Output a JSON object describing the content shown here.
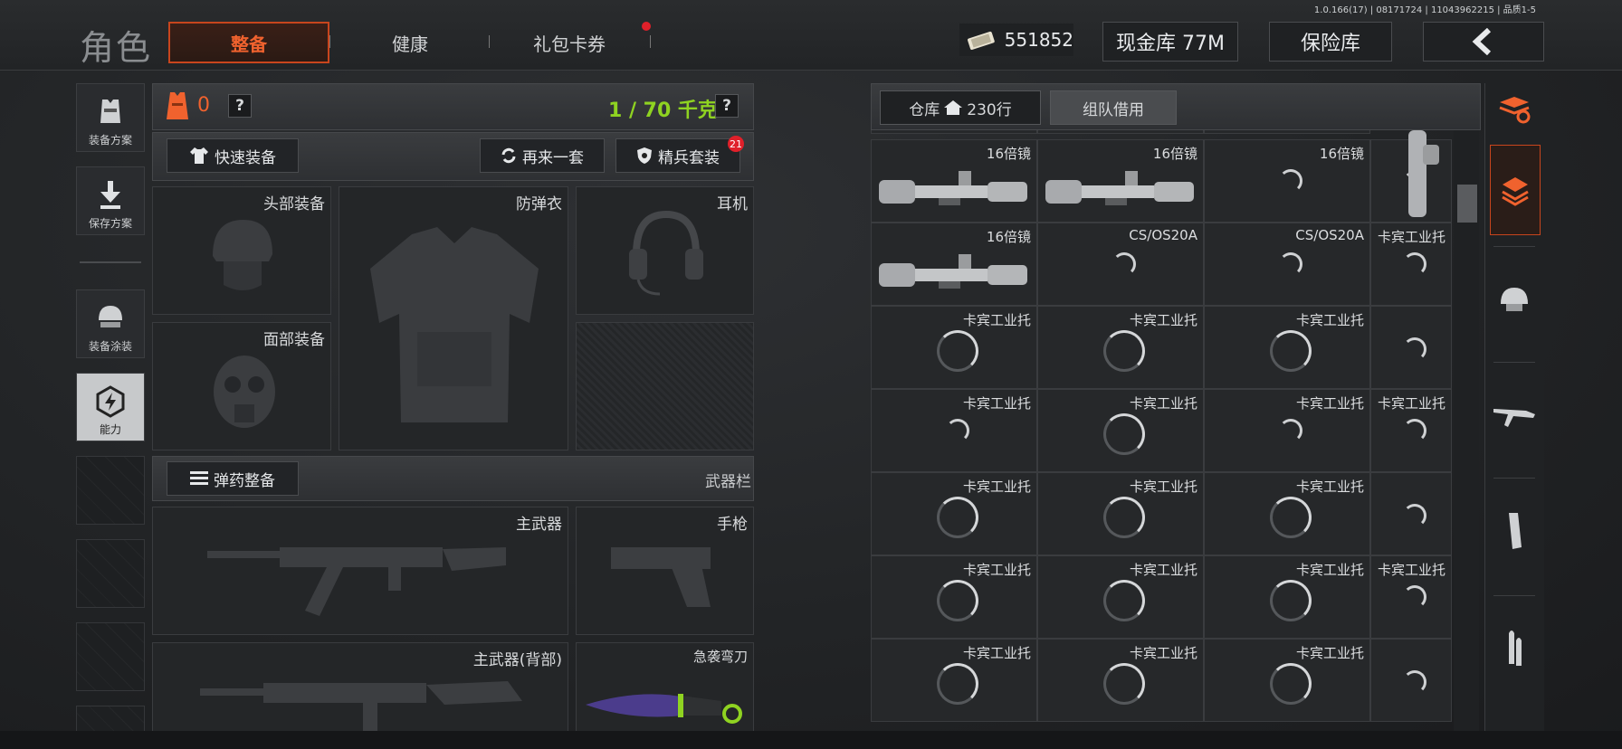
{
  "version": "1.0.166(17) | 08171724 | 11043962215 | 品质1-5",
  "header": {
    "title": "角色",
    "tabs": [
      {
        "label": "整备"
      },
      {
        "label": "健康"
      },
      {
        "label": "礼包卡券"
      }
    ],
    "currency": "551852",
    "cash_vault": "现金库 77M",
    "safe": "保险库"
  },
  "sidebar": {
    "items": [
      {
        "label": "装备方案",
        "icon": "vest-plan-icon"
      },
      {
        "label": "保存方案",
        "icon": "download-icon"
      },
      {
        "label": "装备涂装",
        "icon": "helmet-paint-icon"
      },
      {
        "label": "能力",
        "icon": "ability-icon"
      }
    ]
  },
  "loadout": {
    "armor_count": "0",
    "weight": "1 / 70 千克",
    "quick_equip": "快速装备",
    "repeat": "再来一套",
    "elite": "精兵套装",
    "elite_badge": "21",
    "slots": {
      "head": "头部装备",
      "vest": "防弹衣",
      "ear": "耳机",
      "face": "面部装备"
    },
    "ammo_button": "弹药整备",
    "weapon_bar": "武器栏",
    "weapons": {
      "primary": "主武器",
      "pistol": "手枪",
      "primary_back": "主武器(背部)",
      "knife": "急袭弯刀"
    }
  },
  "warehouse": {
    "tab_label": "仓库",
    "rows": "230行",
    "team_borrow": "组队借用",
    "cells": [
      [
        "16倍镜",
        "16倍镜",
        "16倍镜",
        ""
      ],
      [
        "16倍镜",
        "CS/OS20A",
        "CS/OS20A",
        "卡宾工业托"
      ],
      [
        "卡宾工业托",
        "卡宾工业托",
        "卡宾工业托",
        ""
      ],
      [
        "卡宾工业托",
        "卡宾工业托",
        "卡宾工业托",
        "卡宾工业托"
      ],
      [
        "卡宾工业托",
        "卡宾工业托",
        "卡宾工业托",
        ""
      ],
      [
        "卡宾工业托",
        "卡宾工业托",
        "卡宾工业托",
        "卡宾工业托"
      ],
      [
        "卡宾工业托",
        "卡宾工业托",
        "卡宾工业托",
        ""
      ]
    ]
  },
  "colors": {
    "accent": "#f0622e",
    "weight": "#8fd321",
    "badge": "#e0202a"
  }
}
